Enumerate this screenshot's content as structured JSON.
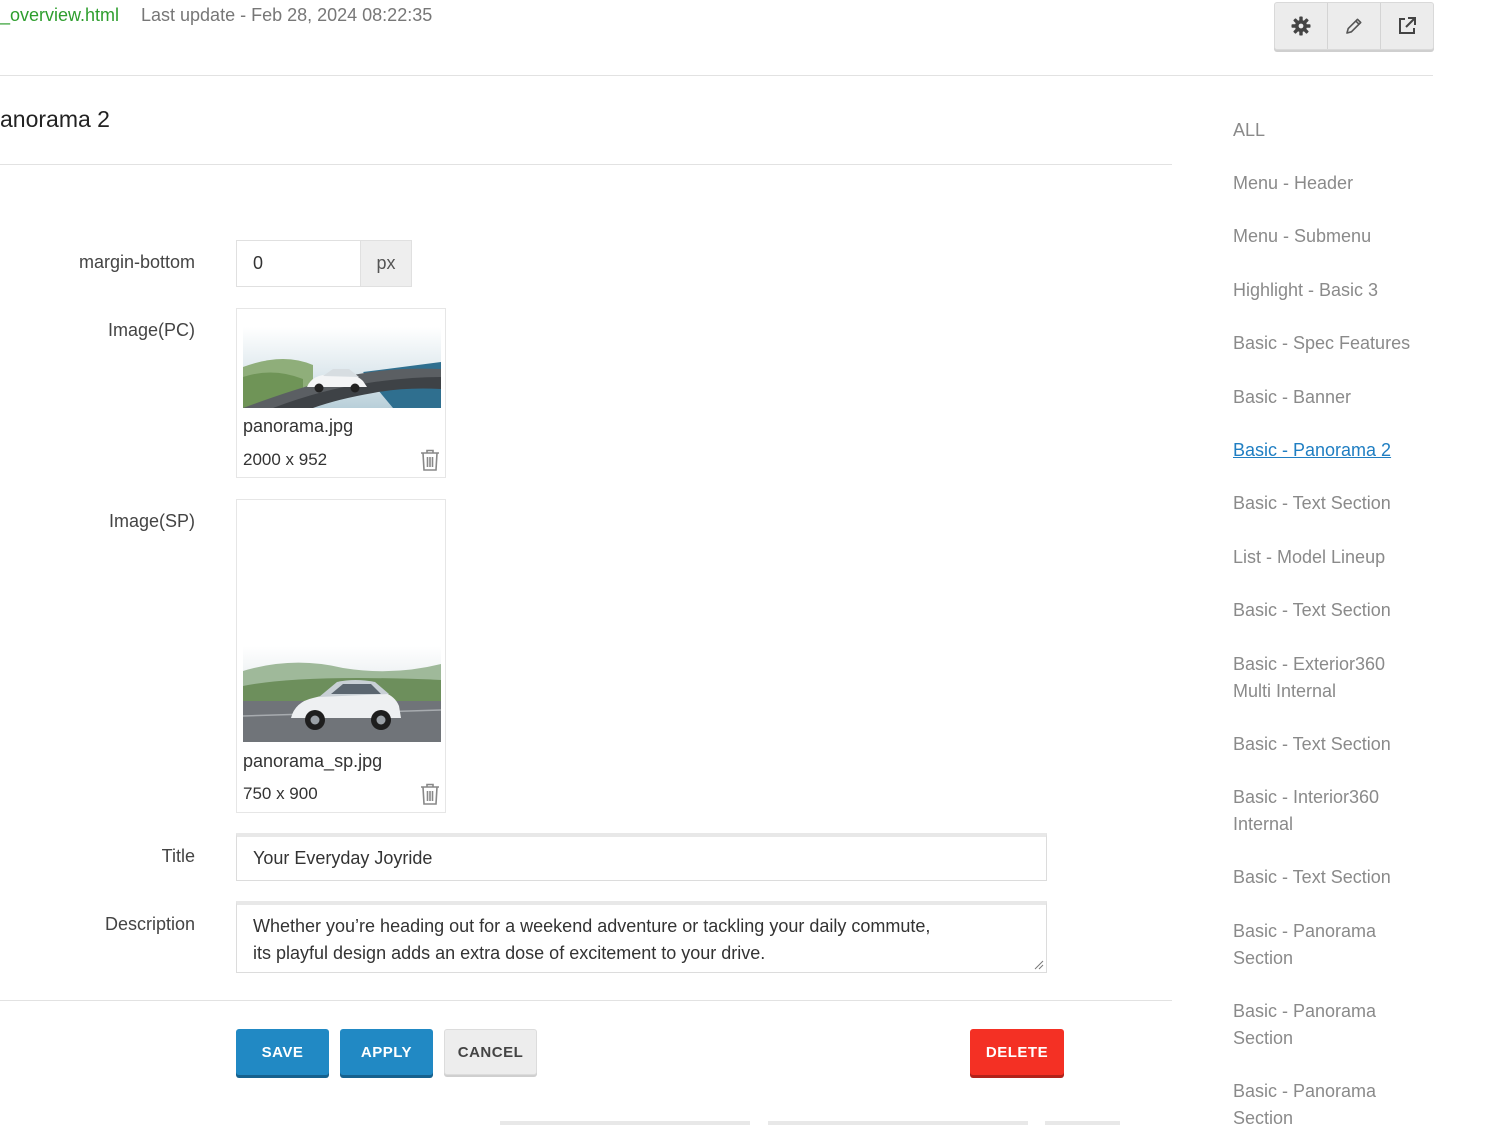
{
  "header": {
    "file_name": "_overview.html",
    "last_update": "Last update - Feb 28, 2024 08:22:35",
    "tools": [
      "gear-icon",
      "pencil-icon",
      "external-link-icon"
    ]
  },
  "panel": {
    "title": "anorama 2"
  },
  "form": {
    "margin_bottom": {
      "label": "margin-bottom",
      "value": "0",
      "unit": "px"
    },
    "image_pc": {
      "label": "Image(PC)",
      "file": "panorama.jpg",
      "dims": "2000 x 952"
    },
    "image_sp": {
      "label": "Image(SP)",
      "file": "panorama_sp.jpg",
      "dims": "750 x 900"
    },
    "title": {
      "label": "Title",
      "value": "Your Everyday Joyride"
    },
    "description": {
      "label": "Description",
      "line1": "Whether you’re heading out for a weekend adventure or tackling your daily commute,",
      "line2": "its playful design adds an extra dose of excitement to your drive."
    }
  },
  "actions": {
    "save": "SAVE",
    "apply": "APPLY",
    "cancel": "CANCEL",
    "delete": "DELETE"
  },
  "colors": {
    "primary": "#2189c4",
    "danger": "#f43024",
    "file_link": "#2e9e2e",
    "active_link": "#1f7ec2"
  },
  "sidebar": {
    "items": [
      {
        "line1": "ALL"
      },
      {
        "line1": "Menu - Header"
      },
      {
        "line1": "Menu - Submenu"
      },
      {
        "line1": "Highlight - Basic 3"
      },
      {
        "line1": "Basic - Spec Features"
      },
      {
        "line1": "Basic - Banner"
      },
      {
        "line1": "Basic - Panorama 2",
        "active": true
      },
      {
        "line1": "Basic - Text Section"
      },
      {
        "line1": "List - Model Lineup"
      },
      {
        "line1": "Basic - Text Section"
      },
      {
        "line1": "Basic - Exterior360",
        "line2": "Multi Internal"
      },
      {
        "line1": "Basic - Text Section"
      },
      {
        "line1": "Basic - Interior360",
        "line2": "Internal"
      },
      {
        "line1": "Basic - Text Section"
      },
      {
        "line1": "Basic - Panorama",
        "line2": "Section"
      },
      {
        "line1": "Basic - Panorama",
        "line2": "Section"
      },
      {
        "line1": "Basic - Panorama",
        "line2": "Section"
      }
    ]
  }
}
